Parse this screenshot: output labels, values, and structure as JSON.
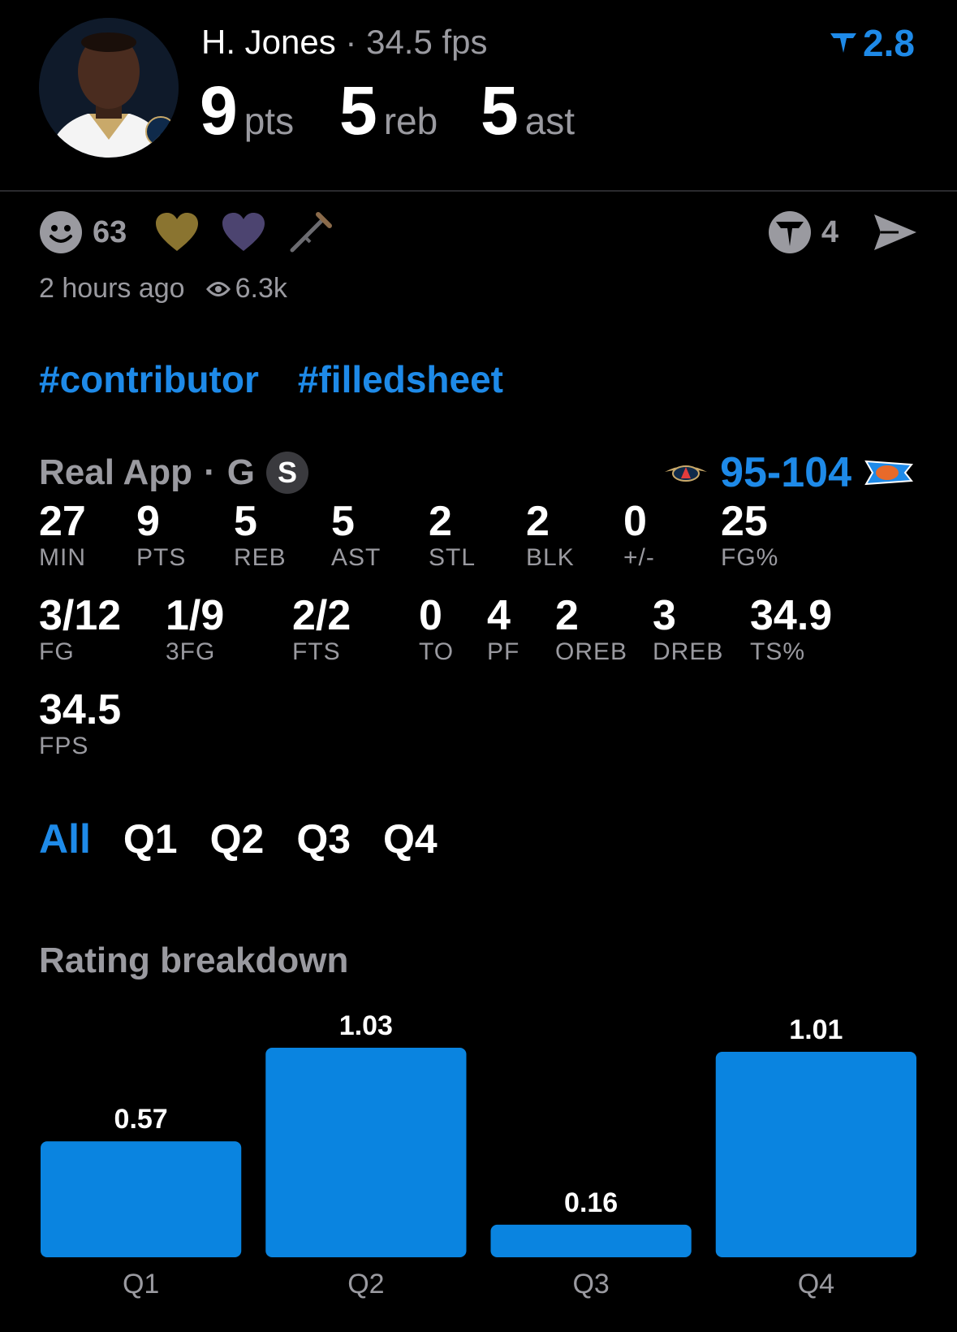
{
  "header": {
    "player_name": "H. Jones",
    "separator": "·",
    "fps_text": "34.5 fps",
    "stats": [
      {
        "value": "9",
        "unit": "pts"
      },
      {
        "value": "5",
        "unit": "reb"
      },
      {
        "value": "5",
        "unit": "ast"
      }
    ],
    "rating": "2.8",
    "colors": {
      "accent": "#1e8ae8",
      "muted": "#9a9aa0",
      "background": "#000000"
    }
  },
  "reactions": {
    "smiley_count": "63",
    "icons": [
      "smiley-icon",
      "gold-heart-icon",
      "purple-heart-icon",
      "crutch-icon"
    ],
    "real_count": "4"
  },
  "meta": {
    "time_ago": "2 hours ago",
    "views": "6.3k"
  },
  "tags": [
    "#contributor",
    "#filledsheet"
  ],
  "source": {
    "app": "Real App",
    "separator": "·",
    "position": "G",
    "badge": "S",
    "score": "95-104",
    "team_left_logo": "pelicans-logo",
    "team_right_logo": "okc-logo"
  },
  "stats_rows": [
    [
      {
        "value": "27",
        "label": "MIN"
      },
      {
        "value": "9",
        "label": "PTS"
      },
      {
        "value": "5",
        "label": "REB"
      },
      {
        "value": "5",
        "label": "AST"
      },
      {
        "value": "2",
        "label": "STL"
      },
      {
        "value": "2",
        "label": "BLK"
      },
      {
        "value": "0",
        "label": "+/-"
      },
      {
        "value": "25",
        "label": "FG%"
      }
    ],
    [
      {
        "value": "3/12",
        "label": "FG"
      },
      {
        "value": "1/9",
        "label": "3FG"
      },
      {
        "value": "2/2",
        "label": "FTS"
      },
      {
        "value": "0",
        "label": "TO"
      },
      {
        "value": "4",
        "label": "PF"
      },
      {
        "value": "2",
        "label": "OREB"
      },
      {
        "value": "3",
        "label": "DREB"
      },
      {
        "value": "34.9",
        "label": "TS%"
      }
    ],
    [
      {
        "value": "34.5",
        "label": "FPS"
      }
    ]
  ],
  "tabs": [
    "All",
    "Q1",
    "Q2",
    "Q3",
    "Q4"
  ],
  "active_tab": "All",
  "chart_title": "Rating breakdown",
  "chart_data": {
    "type": "bar",
    "categories": [
      "Q1",
      "Q2",
      "Q3",
      "Q4"
    ],
    "values": [
      0.57,
      1.03,
      0.16,
      1.01
    ],
    "data_labels": [
      "0.57",
      "1.03",
      "0.16",
      "1.01"
    ],
    "grid": false,
    "bar_color": "#0a84e0"
  }
}
